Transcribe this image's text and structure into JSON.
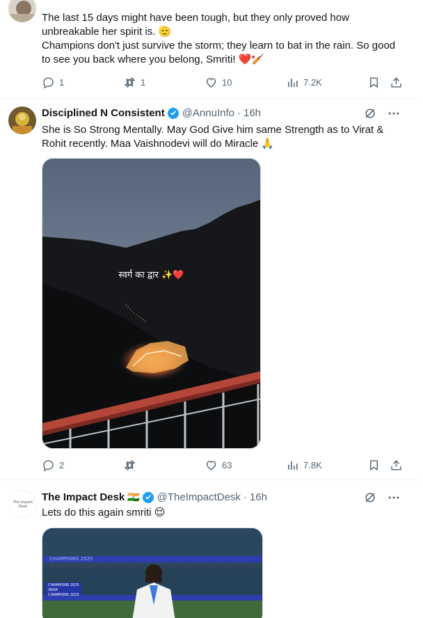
{
  "colors": {
    "text": "#0f1419",
    "secondary": "#536471",
    "verified": "#1d9bf0",
    "divider": "#eff3f4",
    "heart": "#e0245e"
  },
  "tweets": [
    {
      "avatar_icon": "profile-photo-icon",
      "text_lines": [
        "The last 15 days might have been tough, but they only proved how unbreakable her spirit is. 🫡",
        "Champions don't just survive the storm; they learn to bat in the rain. So good to see you back where you belong, Smriti! ❤️🏏"
      ],
      "stats": {
        "replies": "1",
        "reposts": "1",
        "likes": "10",
        "views": "7.2K"
      }
    },
    {
      "display_name": "Disciplined N Consistent",
      "handle": "@AnnuInfo",
      "time": "16h",
      "text": "She is So Strong Mentally. May God Give him same Strength as to Virat & Rohit recently. Maa Vaishnodevi will do Miracle 🙏",
      "media": {
        "overlay_text": "स्वर्ग का द्वार ✨❤️"
      },
      "stats": {
        "replies": "2",
        "reposts": "",
        "likes": "63",
        "views": "7.8K"
      }
    },
    {
      "display_name": "The Impact Desk",
      "flag": "🇮🇳",
      "handle": "@TheImpactDesk",
      "time": "16h",
      "avatar_text": "The Impact Desk",
      "text": "Lets do this again smriti 😌",
      "media": {
        "banner_text": "CHAMPIONS 2025",
        "board_lines": [
          "CHAMPIONS 2025",
          "INDIA",
          "CHAMPIONS 2025"
        ]
      }
    }
  ]
}
